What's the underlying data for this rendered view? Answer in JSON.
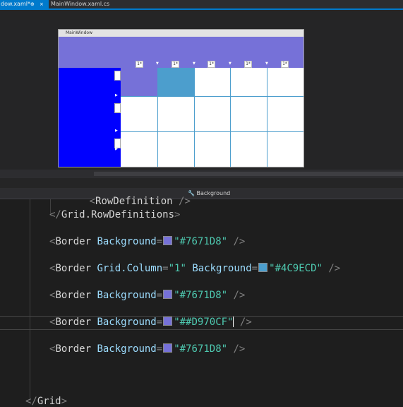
{
  "tabs": [
    {
      "label": "dow.xaml*",
      "pin": "⊕",
      "close": "×"
    },
    {
      "label": "MainWindow.xaml.cs"
    }
  ],
  "designer": {
    "window_title": "MainWindow",
    "column_markers": [
      "1*",
      "1*",
      "1*",
      "1*",
      "1*"
    ],
    "colors": {
      "band": "#7671D8",
      "left": "#0000FF",
      "teal": "#4C9ECD"
    }
  },
  "breadcrumb": {
    "icon": "wrench-icon",
    "label": "Background"
  },
  "code": {
    "line0": {
      "indent": "      ",
      "open": "<",
      "tag": "RowDefinition",
      "close": " />"
    },
    "line1": {
      "open": "</",
      "tag": "Grid.RowDefinitions",
      "close": ">"
    },
    "borders": [
      {
        "attr1": "Background",
        "eq": "=",
        "swatch": "#7671D8",
        "value": "\"#7671D8\"",
        "close": " />"
      },
      {
        "attr0": "Grid.Column",
        "val0": "\"1\"",
        "attr1": "Background",
        "eq": "=",
        "swatch": "#4C9ECD",
        "value": "\"#4C9ECD\"",
        "close": " />"
      },
      {
        "attr1": "Background",
        "eq": "=",
        "swatch": "#7671D8",
        "value": "\"#7671D8\"",
        "close": " />"
      },
      {
        "attr1": "Background",
        "eq": "=",
        "swatch": "#7671D8",
        "value": "\"##D970CF\"",
        "close": " />"
      },
      {
        "attr1": "Background",
        "eq": "=",
        "swatch": "#7671D8",
        "value": "\"#7671D8\"",
        "close": " />"
      }
    ],
    "tag_name": "Border",
    "last": {
      "open": "</",
      "tag": "Grid",
      "close": ">"
    }
  }
}
